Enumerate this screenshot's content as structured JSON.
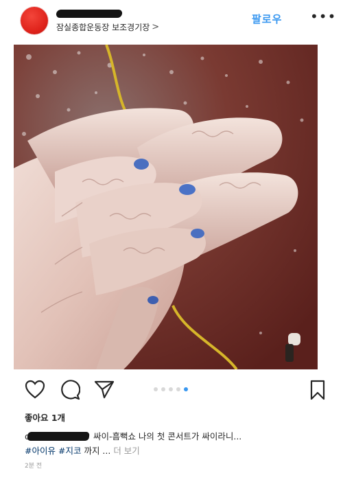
{
  "header": {
    "location": "잠실종합운동장 보조경기장",
    "location_chevron": ">",
    "follow_label": "팔로우",
    "more_label": "•••"
  },
  "post": {
    "image_description_icon": "photo-icon"
  },
  "actions": {
    "carousel_count": 5,
    "carousel_active_index": 4
  },
  "engagement": {
    "likes": "좋아요 1개",
    "caption_lead": "d",
    "caption_text": "싸이-흠뻑쇼 나의 첫 콘서트가 싸이라니...",
    "tag1": "#아이유",
    "tag2": "#지코",
    "tag_rest": "까지 ...",
    "more": "더 보기",
    "time": "2분 전"
  },
  "colors": {
    "accent": "#3897f0",
    "hashtag": "#003569",
    "avatar": "#e0241c"
  }
}
